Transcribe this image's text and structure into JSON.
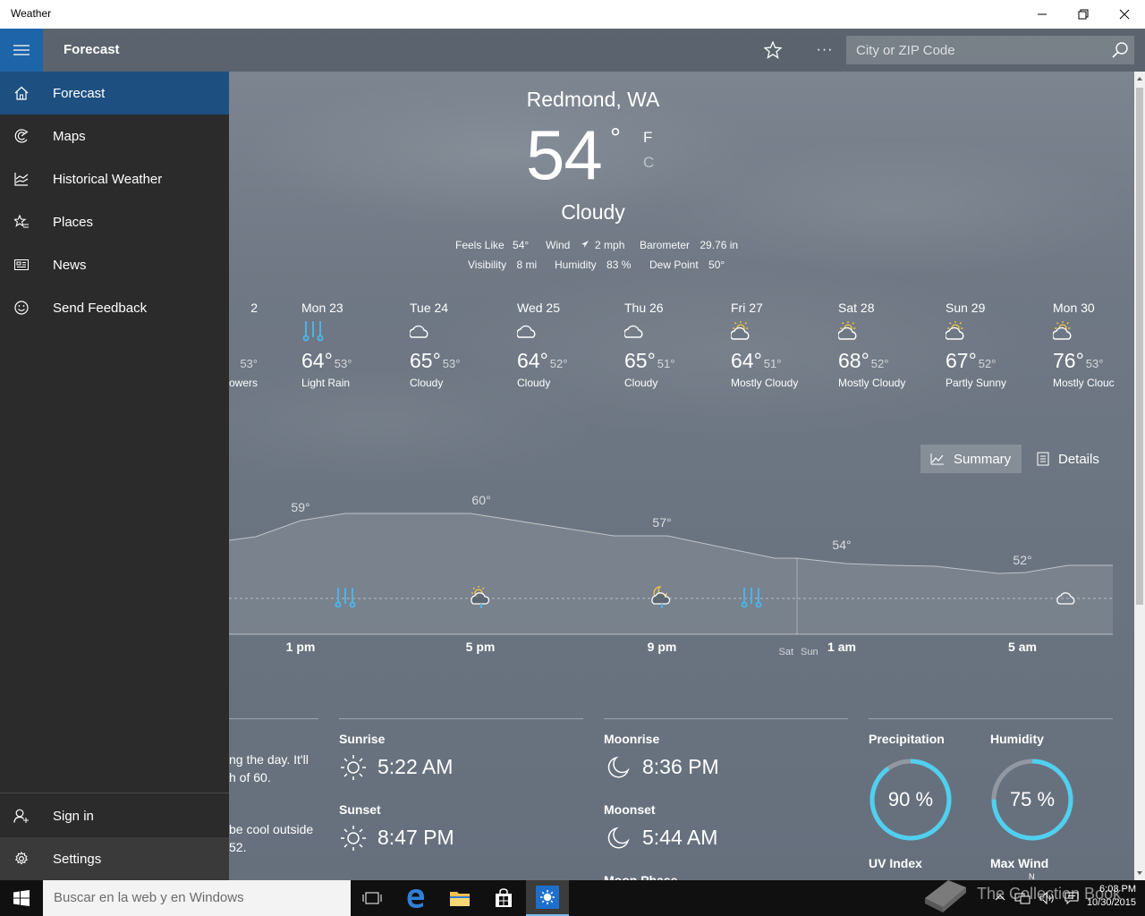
{
  "window": {
    "title": "Weather"
  },
  "appbar": {
    "section_title": "Forecast",
    "more_label": "···",
    "search_placeholder": "City or ZIP Code"
  },
  "nav": {
    "items": [
      {
        "label": "Forecast",
        "icon": "home-icon"
      },
      {
        "label": "Maps",
        "icon": "radar-icon"
      },
      {
        "label": "Historical Weather",
        "icon": "chart-icon"
      },
      {
        "label": "Places",
        "icon": "star-list-icon"
      },
      {
        "label": "News",
        "icon": "news-icon"
      },
      {
        "label": "Send Feedback",
        "icon": "smiley-icon"
      }
    ],
    "footer": [
      {
        "label": "Sign in",
        "icon": "person-add-icon"
      },
      {
        "label": "Settings",
        "icon": "gear-icon"
      }
    ]
  },
  "current": {
    "location": "Redmond, WA",
    "temp": "54",
    "degree": "°",
    "unit_f": "F",
    "unit_c": "C",
    "condition": "Cloudy",
    "feels_like_label": "Feels Like",
    "feels_like": "54°",
    "wind_label": "Wind",
    "wind": "2 mph",
    "barometer_label": "Barometer",
    "barometer": "29.76 in",
    "visibility_label": "Visibility",
    "visibility": "8 mi",
    "humidity_label": "Humidity",
    "humidity": "83 %",
    "dew_point_label": "Dew Point",
    "dew_point": "50°"
  },
  "daily": [
    {
      "day": "2",
      "hi": "",
      "lo": "53°",
      "cond": "owers",
      "icon": "none"
    },
    {
      "day": "Mon 23",
      "hi": "64°",
      "lo": "53°",
      "cond": "Light Rain",
      "icon": "rain-icon"
    },
    {
      "day": "Tue 24",
      "hi": "65°",
      "lo": "53°",
      "cond": "Cloudy",
      "icon": "cloud-icon"
    },
    {
      "day": "Wed 25",
      "hi": "64°",
      "lo": "52°",
      "cond": "Cloudy",
      "icon": "cloud-icon"
    },
    {
      "day": "Thu 26",
      "hi": "65°",
      "lo": "51°",
      "cond": "Cloudy",
      "icon": "cloud-icon"
    },
    {
      "day": "Fri 27",
      "hi": "64°",
      "lo": "51°",
      "cond": "Mostly Cloudy",
      "icon": "sun-cloud-icon"
    },
    {
      "day": "Sat 28",
      "hi": "68°",
      "lo": "52°",
      "cond": "Mostly Cloudy",
      "icon": "sun-cloud-icon"
    },
    {
      "day": "Sun 29",
      "hi": "67°",
      "lo": "52°",
      "cond": "Partly Sunny",
      "icon": "sun-cloud-icon"
    },
    {
      "day": "Mon 30",
      "hi": "76°",
      "lo": "53°",
      "cond": "Mostly Clouc",
      "icon": "sun-cloud-icon"
    }
  ],
  "view_toggle": {
    "summary": "Summary",
    "details": "Details"
  },
  "hourly": {
    "temp_labels": [
      "59°",
      "60°",
      "57°",
      "54°",
      "52°"
    ],
    "hours": [
      "1 pm",
      "5 pm",
      "9 pm",
      "1 am",
      "5 am"
    ],
    "day_split": [
      "Sat",
      "Sun"
    ]
  },
  "summary_text": {
    "line1": "ng the day. It'll",
    "line2": "h of 60.",
    "line3": "be cool outside",
    "line4": "52."
  },
  "sun": {
    "sunrise_label": "Sunrise",
    "sunrise": "5:22 AM",
    "sunset_label": "Sunset",
    "sunset": "8:47 PM"
  },
  "moon": {
    "moonrise_label": "Moonrise",
    "moonrise": "8:36 PM",
    "moonset_label": "Moonset",
    "moonset": "5:44 AM",
    "phase_label": "Moon Phase"
  },
  "stats": {
    "precip_label": "Precipitation",
    "precip": "90 %",
    "precip_value": 0.9,
    "humidity_label": "Humidity",
    "humidity": "75 %",
    "humidity_value": 0.75,
    "uv_label": "UV Index",
    "wind_label": "Max Wind",
    "wind_dir": "N"
  },
  "taskbar": {
    "search_placeholder": "Buscar en la web y en Windows",
    "time": "6:03 PM",
    "date": "10/30/2015",
    "watermark": "The Collection Book"
  },
  "colors": {
    "accent": "#1e64a8",
    "ring": "#4fd0f0",
    "rain": "#4ab4e8",
    "sun": "#f5c842"
  }
}
